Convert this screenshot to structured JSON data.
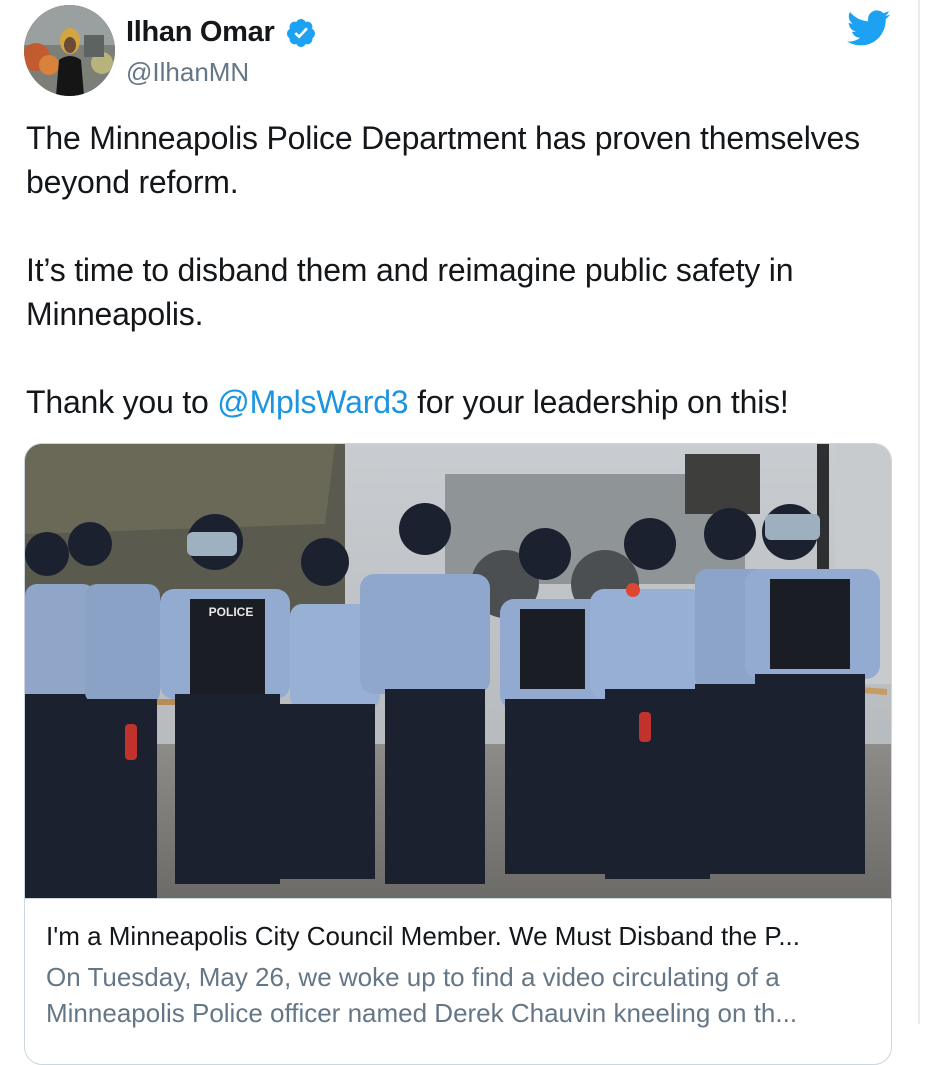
{
  "user": {
    "display_name": "Ilhan Omar",
    "handle": "@IlhanMN",
    "verified": true
  },
  "icons": {
    "verified": "verified-badge-icon",
    "brand": "twitter-bird-icon"
  },
  "colors": {
    "mention": "#1b95e0",
    "verified": "#1da1f2",
    "secondary_text": "#657786",
    "brand": "#1da1f2"
  },
  "tweet": {
    "paragraph1": "The Minneapolis Police Department has proven themselves beyond reform.",
    "paragraph2": "It’s time to disband them and reimagine public safety in Minneapolis.",
    "paragraph3_before": "Thank you to ",
    "paragraph3_mention": "@MplsWard3",
    "paragraph3_after": " for your leadership on this!"
  },
  "card": {
    "image_label": "POLICE",
    "title": "I'm a Minneapolis City Council Member. We Must Disband the P...",
    "description": "On Tuesday, May 26, we woke up to find a video circulating of a Minneapolis Police officer named Derek Chauvin kneeling on th..."
  }
}
